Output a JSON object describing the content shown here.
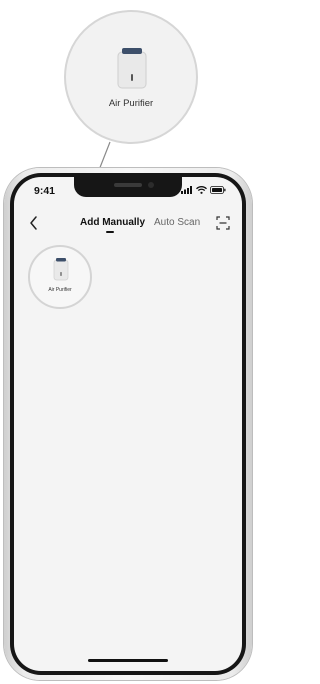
{
  "zoom_callout": {
    "device_label": "Air Purifier"
  },
  "status_bar": {
    "time": "9:41",
    "icons": [
      "signal-icon",
      "wifi-icon",
      "battery-icon"
    ]
  },
  "nav": {
    "back_icon": "chevron-left-icon",
    "tabs": [
      {
        "label": "Add Manually",
        "active": true
      },
      {
        "label": "Auto Scan",
        "active": false
      }
    ],
    "scan_icon": "scan-frame-icon"
  },
  "device_list": [
    {
      "label": "Air Purifier",
      "icon": "air-purifier-icon"
    }
  ],
  "colors": {
    "accent_dark": "#111111",
    "device_top": "#3d4f6a",
    "device_body": "#ececec",
    "screen_bg": "#f4f4f4"
  }
}
